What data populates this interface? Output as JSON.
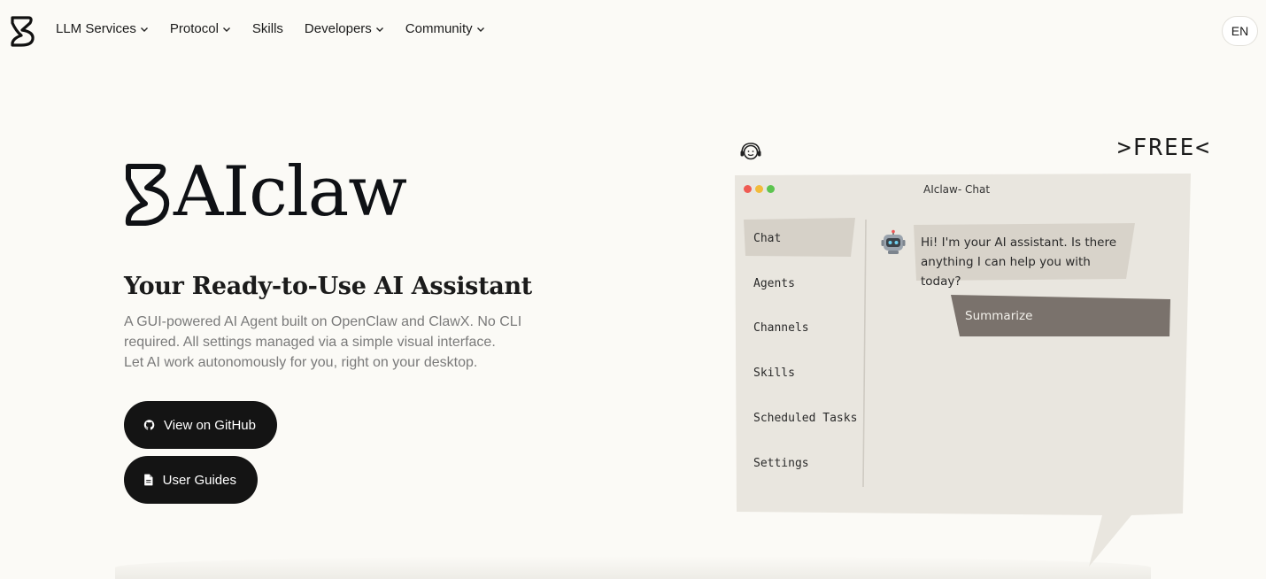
{
  "nav": {
    "items": [
      {
        "label": "LLM Services",
        "has_dropdown": true
      },
      {
        "label": "Protocol",
        "has_dropdown": true
      },
      {
        "label": "Skills",
        "has_dropdown": false
      },
      {
        "label": "Developers",
        "has_dropdown": true
      },
      {
        "label": "Community",
        "has_dropdown": true
      }
    ],
    "language": "EN"
  },
  "hero": {
    "brand": "AIclaw",
    "title": "Your Ready-to-Use AI Assistant",
    "description_lines": [
      "A GUI-powered AI Agent built on OpenClaw and ClawX. No CLI",
      "required. All settings managed via a simple visual interface.",
      "Let AI work autonomously for you, right on your desktop."
    ],
    "buttons": {
      "github": "View on GitHub",
      "guides": "User Guides"
    }
  },
  "mock": {
    "free_label": ">FREE<",
    "window_title": "AIclaw- Chat",
    "sidebar": [
      "Chat",
      "Agents",
      "Channels",
      "Skills",
      "Scheduled Tasks",
      "Settings"
    ],
    "assistant_message": "Hi! I'm your AI assistant. Is there anything I can help you with today?",
    "action_label": "Summarize"
  },
  "colors": {
    "background": "#fbfaf6",
    "button": "#141414",
    "mock_window": "#e9e6df",
    "action": "#7a726c"
  }
}
